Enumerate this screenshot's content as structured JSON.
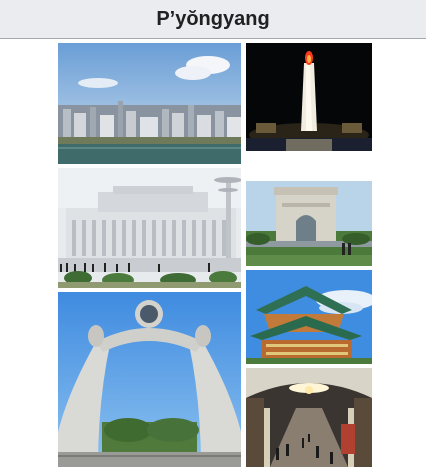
{
  "infobox": {
    "title": "P’yŏngyang"
  },
  "images": [
    {
      "name": "city-skyline-photo"
    },
    {
      "name": "juche-tower-night-photo"
    },
    {
      "name": "kumsusan-palace-photo"
    },
    {
      "name": "arch-of-triumph-photo"
    },
    {
      "name": "monument-to-reunification-photo"
    },
    {
      "name": "pagoda-roof-building-photo"
    },
    {
      "name": "metro-station-photo"
    }
  ]
}
